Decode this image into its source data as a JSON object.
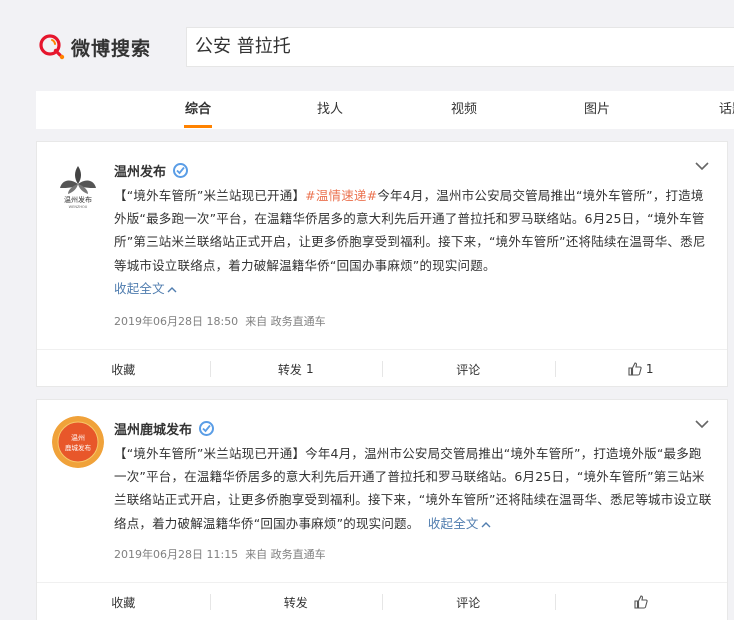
{
  "header": {
    "logo_text": "微博搜索",
    "search_value": "公安 普拉托"
  },
  "tabs": [
    {
      "label": "综合",
      "active": true
    },
    {
      "label": "找人",
      "active": false
    },
    {
      "label": "视频",
      "active": false
    },
    {
      "label": "图片",
      "active": false
    },
    {
      "label": "话题",
      "active": false
    }
  ],
  "colors": {
    "accent": "#ff8200",
    "hashtag": "#eb7350",
    "link": "#507daf",
    "verify": "#5a9de6"
  },
  "posts": [
    {
      "user": "温州发布",
      "avatar_text_line1": "温州发布",
      "avatar_text_line2": "WENZHOU",
      "text_part1": "【“境外车管所”米兰站现已开通】",
      "hashtag": "#温情速递#",
      "text_part2": "今年4月，温州市公安局交管局推出“境外车管所”，打造境外版“最多跑一次”平台，在温籍华侨居多的意大利先后开通了普拉托和罗马联络站。6月25日，“境外车管所”第三站米兰联络站正式开启，让更多侨胞享受到福利。接下来，“境外车管所”还将陆续在温哥华、悉尼等城市设立联络点，着力破解温籍华侨“回国办事麻烦”的现实问题。",
      "collapse": "收起全文",
      "time": "2019年06月28日 18:50",
      "source": "来自 政务直通车",
      "actions": {
        "favorite": "收藏",
        "repost": "转发",
        "repost_count": "1",
        "comment": "评论",
        "like_count": "1"
      }
    },
    {
      "user": "温州鹿城发布",
      "avatar_text_line1": "温州",
      "avatar_text_line2": "鹿城发布",
      "text": "【“境外车管所”米兰站现已开通】今年4月，温州市公安局交管局推出“境外车管所”，打造境外版“最多跑一次”平台，在温籍华侨居多的意大利先后开通了普拉托和罗马联络站。6月25日，“境外车管所”第三站米兰联络站正式开启，让更多侨胞享受到福利。接下来，“境外车管所”还将陆续在温哥华、悉尼等城市设立联络点，着力破解温籍华侨“回国办事麻烦”的现实问题。",
      "collapse": "收起全文",
      "time": "2019年06月28日 11:15",
      "source": "来自 政务直通车",
      "actions": {
        "favorite": "收藏",
        "repost": "转发",
        "comment": "评论"
      }
    }
  ]
}
